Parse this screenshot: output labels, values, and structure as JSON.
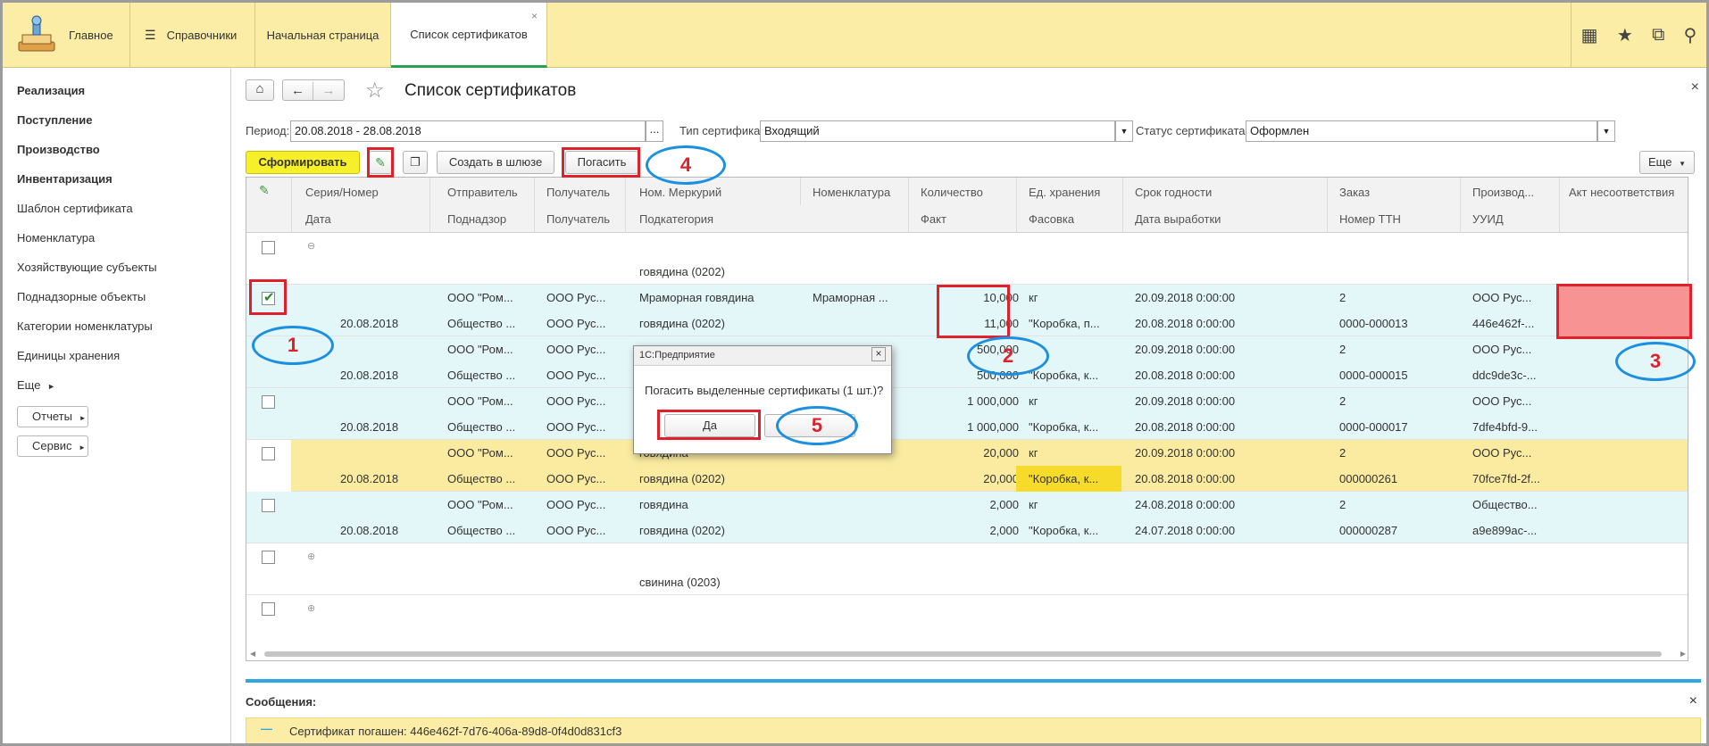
{
  "topbar": {
    "tabs": [
      {
        "label": "Главное"
      },
      {
        "label": "Справочники"
      },
      {
        "label": "Начальная страница"
      },
      {
        "label": "Список сертификатов"
      }
    ],
    "close_glyph": "×"
  },
  "sidebar": {
    "items": [
      {
        "label": "Реализация"
      },
      {
        "label": "Поступление"
      },
      {
        "label": "Производство"
      },
      {
        "label": "Инвентаризация"
      },
      {
        "label": "Шаблон сертификата"
      },
      {
        "label": "Номенклатура"
      },
      {
        "label": "Хозяйствующие субъекты"
      },
      {
        "label": "Поднадзорные объекты"
      },
      {
        "label": "Категории номенклатуры"
      },
      {
        "label": "Единицы хранения"
      },
      {
        "label": "Еще"
      }
    ],
    "buttons": [
      {
        "label": "Отчеты"
      },
      {
        "label": "Сервис"
      }
    ]
  },
  "page": {
    "title": "Список сертификатов",
    "close_glyph": "×"
  },
  "filters": {
    "period_label": "Период:",
    "period_value": "20.08.2018 - 28.08.2018",
    "period_btn": "...",
    "type_label": "Тип сертификата:",
    "type_value": "Входящий",
    "status_label": "Статус сертификата:",
    "status_value": "Оформлен"
  },
  "toolbar": {
    "form_btn": "Сформировать",
    "gateway_btn": "Создать в шлюзе",
    "repay_btn": "Погасить",
    "more_btn": "Еще"
  },
  "table": {
    "headers_top": [
      "Серия/Номер",
      "Отправитель",
      "Получатель",
      "Ном. Меркурий",
      "Номенклатура",
      "Количество",
      "Ед. хранения",
      "Срок годности",
      "Заказ",
      "Производ...",
      "Акт несоответствия"
    ],
    "headers_bottom": [
      "Дата",
      "Поднадзор",
      "Получатель",
      "Подкатегория",
      "",
      "Факт",
      "Фасовка",
      "Дата выработки",
      "Номер ТТН",
      "УУИД",
      ""
    ],
    "group_rows": [
      {
        "label": "говядина (0202)"
      },
      {
        "label": "свинина (0203)"
      }
    ],
    "rows": [
      {
        "top": {
          "sender": "ООО \"Ром...",
          "recipient": "ООО Рус...",
          "nom_merc": "Мраморная говядина",
          "nomenclature": "Мраморная ...",
          "qty": "10,000",
          "unit": "кг",
          "expiry": "20.09.2018 0:00:00",
          "order": "2",
          "producer": "ООО Рус..."
        },
        "bottom": {
          "date": "20.08.2018",
          "supervised": "Общество ...",
          "recipient": "ООО Рус...",
          "subcat": "говядина (0202)",
          "fact": "11,000",
          "pack": "\"Коробка, п...",
          "prod_date": "20.08.2018 0:00:00",
          "ttn": "0000-000013",
          "uuid": "446e462f-..."
        }
      },
      {
        "top": {
          "sender": "ООО \"Ром...",
          "recipient": "ООО Рус...",
          "nom_merc": "",
          "nomenclature": "",
          "qty": "500,000",
          "unit": "",
          "expiry": "20.09.2018 0:00:00",
          "order": "2",
          "producer": "ООО Рус..."
        },
        "bottom": {
          "date": "20.08.2018",
          "supervised": "Общество ...",
          "recipient": "ООО Рус...",
          "subcat": "",
          "fact": "500,000",
          "pack": "\"Коробка, к...",
          "prod_date": "20.08.2018 0:00:00",
          "ttn": "0000-000015",
          "uuid": "ddc9de3c-..."
        }
      },
      {
        "top": {
          "sender": "ООО \"Ром...",
          "recipient": "ООО Рус...",
          "nom_merc": "",
          "nomenclature": "",
          "qty": "1 000,000",
          "unit": "кг",
          "expiry": "20.09.2018 0:00:00",
          "order": "2",
          "producer": "ООО Рус..."
        },
        "bottom": {
          "date": "20.08.2018",
          "supervised": "Общество ...",
          "recipient": "ООО Рус...",
          "subcat": "",
          "fact": "1 000,000",
          "pack": "\"Коробка, к...",
          "prod_date": "20.08.2018 0:00:00",
          "ttn": "0000-000017",
          "uuid": "7dfe4bfd-9..."
        }
      },
      {
        "top": {
          "sender": "ООО \"Ром...",
          "recipient": "ООО Рус...",
          "nom_merc": "говядина",
          "nomenclature": "",
          "qty": "20,000",
          "unit": "кг",
          "expiry": "20.09.2018 0:00:00",
          "order": "2",
          "producer": "ООО Рус..."
        },
        "bottom": {
          "date": "20.08.2018",
          "supervised": "Общество ...",
          "recipient": "ООО Рус...",
          "subcat": "говядина (0202)",
          "fact": "20,000",
          "pack": "\"Коробка, к...",
          "prod_date": "20.08.2018 0:00:00",
          "ttn": "000000261",
          "uuid": "70fce7fd-2f..."
        }
      },
      {
        "top": {
          "sender": "ООО \"Ром...",
          "recipient": "ООО Рус...",
          "nom_merc": "говядина",
          "nomenclature": "",
          "qty": "2,000",
          "unit": "кг",
          "expiry": "24.08.2018 0:00:00",
          "order": "2",
          "producer": "Общество..."
        },
        "bottom": {
          "date": "20.08.2018",
          "supervised": "Общество ...",
          "recipient": "ООО Рус...",
          "subcat": "говядина (0202)",
          "fact": "2,000",
          "pack": "\"Коробка, к...",
          "prod_date": "24.07.2018 0:00:00",
          "ttn": "000000287",
          "uuid": "a9e899ac-..."
        }
      }
    ]
  },
  "dialog": {
    "title": "1С:Предприятие",
    "message": "Погасить выделенные сертификаты (1 шт.)?",
    "yes": "Да",
    "close": "×"
  },
  "messages": {
    "title": "Сообщения:",
    "text": "Сертификат погашен: 446e462f-7d76-406a-89d8-0f4d0d831cf3",
    "close": "×"
  },
  "annotations": [
    "1",
    "2",
    "3",
    "4",
    "5"
  ],
  "colors": {
    "topbar": "#fbeda6",
    "accent_yellow": "#f7ef2a",
    "row_tint": "#e3f6f8",
    "row_selected": "#faeba0",
    "annotation_red": "#e0202a",
    "annotation_blue": "#1c8fe0",
    "act_red_fill": "#f79393"
  }
}
